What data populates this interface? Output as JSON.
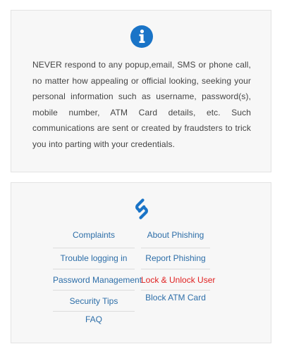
{
  "info_card": {
    "icon": "info-circle-icon",
    "message": "NEVER respond to any popup,email, SMS or phone call, no matter how appealing or official looking, seeking your personal information such as username, password(s), mobile number, ATM Card details, etc. Such communications are sent or created by fraudsters to trick you into parting with your credentials."
  },
  "links_card": {
    "icon": "link-chain-icon",
    "left_links": [
      {
        "label": "Complaints"
      },
      {
        "label": "Trouble logging in"
      },
      {
        "label": "Password Management"
      },
      {
        "label": "Security Tips"
      },
      {
        "label": "FAQ"
      }
    ],
    "right_links": [
      {
        "label": "About Phishing"
      },
      {
        "label": "Report Phishing"
      },
      {
        "label": "Lock & Unlock User",
        "highlight": true
      },
      {
        "label": "Block ATM Card"
      }
    ]
  },
  "colors": {
    "accent_blue": "#2d6ea8",
    "icon_blue": "#1a74c7",
    "highlight_red": "#e02020",
    "card_bg": "#f7f7f7",
    "text": "#444444"
  }
}
